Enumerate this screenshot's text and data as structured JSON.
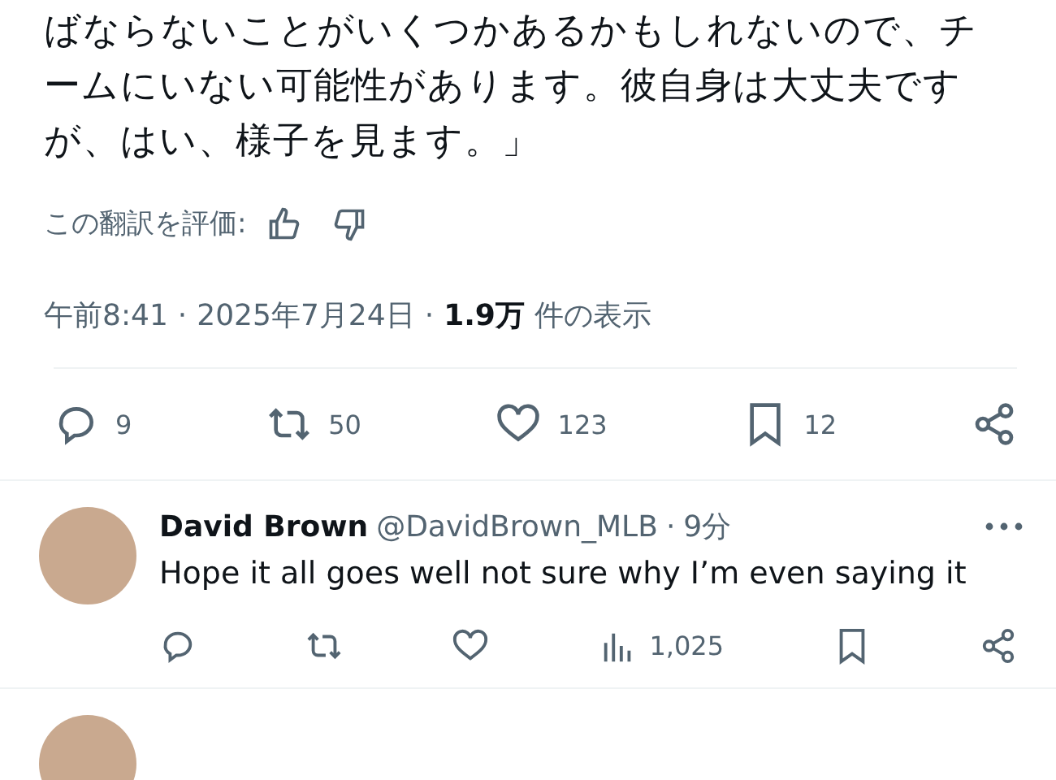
{
  "tweet": {
    "text": "ばならないことがいくつかあるかもしれないので、チームにいない可能性があります。彼自身は大丈夫ですが、はい、様子を見ます。」",
    "rate_label": "この翻訳を評価:",
    "separator": "·",
    "time": "午前8:41",
    "date": "2025年7月24日",
    "views_count": "1.9万",
    "views_label": "件の表示",
    "actions": [
      {
        "kind": "reply",
        "count": "9"
      },
      {
        "kind": "repost",
        "count": "50"
      },
      {
        "kind": "like",
        "count": "123"
      },
      {
        "kind": "bookmark",
        "count": "12"
      },
      {
        "kind": "share"
      }
    ]
  },
  "replies": [
    {
      "name": "David Brown",
      "handle": "@DavidBrown_MLB",
      "separator": "·",
      "age": "9分",
      "text": "Hope it all goes well not sure why I’m even saying it",
      "actions": [
        {
          "kind": "reply"
        },
        {
          "kind": "repost"
        },
        {
          "kind": "like"
        },
        {
          "kind": "views",
          "count": "1,025"
        },
        {
          "kind": "bookmark"
        },
        {
          "kind": "share"
        }
      ]
    }
  ]
}
